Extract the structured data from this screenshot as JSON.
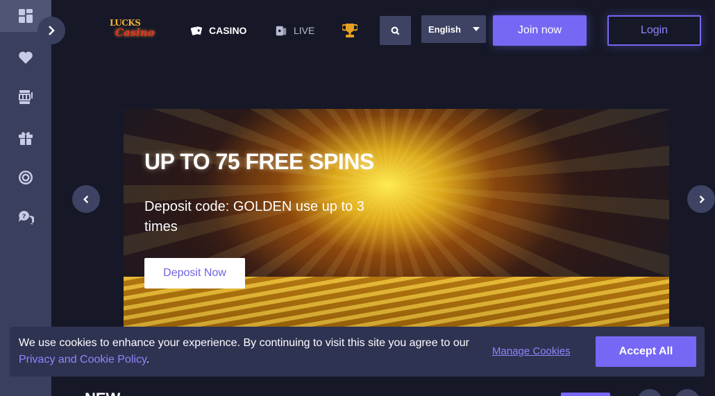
{
  "header": {
    "logo_text_top": "LUCKS",
    "logo_text_bottom": "Casino",
    "nav": [
      {
        "label": "CASINO",
        "icon": "cards-icon"
      },
      {
        "label": "LIVE",
        "icon": "live-dealer-icon"
      }
    ],
    "language": "English",
    "join_label": "Join now",
    "login_label": "Login"
  },
  "sidebar": {
    "items": [
      {
        "name": "dashboard",
        "icon": "grid-icon",
        "active": true
      },
      {
        "name": "favorites",
        "icon": "heart-icon"
      },
      {
        "name": "slots",
        "icon": "slot-machine-icon"
      },
      {
        "name": "promotions",
        "icon": "gift-icon"
      },
      {
        "name": "vip",
        "icon": "target-icon"
      },
      {
        "name": "support",
        "icon": "help-chat-icon"
      }
    ]
  },
  "banner": {
    "title": "UP TO 75 FREE SPINS",
    "subtitle": "Deposit code: GOLDEN use up to 3 times",
    "cta_label": "Deposit Now"
  },
  "section": {
    "partial_title": "NEW"
  },
  "cookie": {
    "text_prefix": "We use cookies to enhance your experience. By continuing to visit this site you agree to our ",
    "policy_link": "Privacy and Cookie Policy",
    "text_suffix": ".",
    "manage_label": "Manage Cookies",
    "accept_label": "Accept All"
  },
  "colors": {
    "background": "#161827",
    "sidebar": "#3a3f5e",
    "accent": "#7668f4",
    "link": "#8f86ff"
  }
}
